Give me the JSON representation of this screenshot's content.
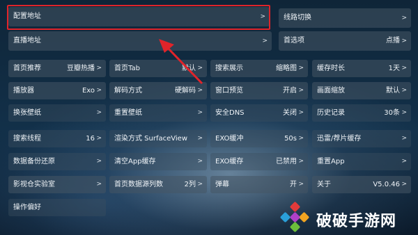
{
  "config": {
    "label": "配置地址",
    "chev": ">"
  },
  "live": {
    "label": "直播地址",
    "chev": ">"
  },
  "line_switch": {
    "label": "线路切换",
    "chev": ">"
  },
  "home_option": {
    "label": "首选项",
    "value": "点播",
    "chev": ">"
  },
  "settings": [
    {
      "label": "首页推荐",
      "value": "豆瓣热播"
    },
    {
      "label": "首页Tab",
      "value": "默认"
    },
    {
      "label": "搜索展示",
      "value": "缩略图"
    },
    {
      "label": "缓存时长",
      "value": "1天"
    },
    {
      "label": "播放器",
      "value": "Exo"
    },
    {
      "label": "解码方式",
      "value": "硬解码"
    },
    {
      "label": "窗口预览",
      "value": "开启"
    },
    {
      "label": "画面缩放",
      "value": "默认"
    },
    {
      "label": "换张壁纸",
      "value": ""
    },
    {
      "label": "重置壁纸",
      "value": ""
    },
    {
      "label": "安全DNS",
      "value": "关闭"
    },
    {
      "label": "历史记录",
      "value": "30条"
    },
    {
      "label": "搜索线程",
      "value": "16"
    },
    {
      "label": "渲染方式 SurfaceView",
      "value": ""
    },
    {
      "label": "EXO缓冲",
      "value": "50s"
    },
    {
      "label": "迅雷/荐片缓存",
      "value": ""
    },
    {
      "label": "数据备份还原",
      "value": ""
    },
    {
      "label": "清空App缓存",
      "value": ""
    },
    {
      "label": "EXO缓存",
      "value": "已禁用"
    },
    {
      "label": "重置App",
      "value": ""
    },
    {
      "label": "影视仓实验室",
      "value": ""
    },
    {
      "label": "首页数据源列数",
      "value": "2列"
    },
    {
      "label": "弹幕",
      "value": "开"
    },
    {
      "label": "关于",
      "value": "V5.0.46"
    }
  ],
  "operation": {
    "label": "操作偏好"
  },
  "chev": ">",
  "watermark": {
    "text": "破破手游网"
  },
  "colors": {
    "highlight": "#e0242a",
    "cell_bg": "#46556a"
  }
}
